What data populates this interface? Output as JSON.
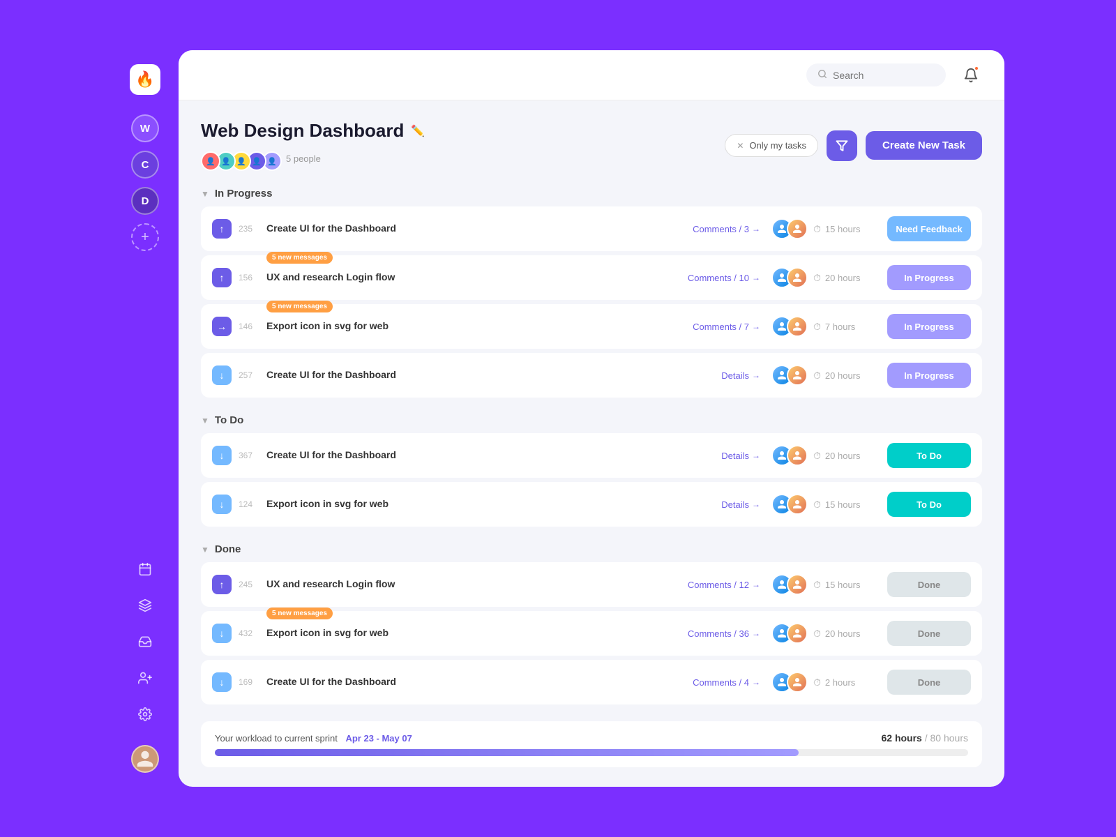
{
  "app": {
    "logo": "🔥",
    "search_placeholder": "Search"
  },
  "sidebar": {
    "workspaces": [
      {
        "label": "W",
        "class": "w"
      },
      {
        "label": "C",
        "class": "c"
      },
      {
        "label": "D",
        "class": "d"
      }
    ],
    "add_label": "+",
    "icons": [
      "📅",
      "⬡",
      "📥",
      "👤",
      "⚙️"
    ]
  },
  "header": {
    "title": "Web Design Dashboard",
    "people_count": "5 people",
    "filter_label": "Only my tasks",
    "create_btn": "Create New Task"
  },
  "sections": [
    {
      "id": "in-progress",
      "title": "In Progress",
      "tasks": [
        {
          "id": 235,
          "name": "Create UI for the Dashboard",
          "priority": "up",
          "link_label": "Comments / 3",
          "link_arrow": "→",
          "hours": "15 hours",
          "status": "Need Feedback",
          "status_class": "status-need-feedback",
          "badge": null
        },
        {
          "id": 156,
          "name": "UX and research Login flow",
          "priority": "up",
          "link_label": "Comments / 10",
          "link_arrow": "→",
          "hours": "20 hours",
          "status": "In Progress",
          "status_class": "status-in-progress",
          "badge": "5 new messages"
        },
        {
          "id": 146,
          "name": "Export icon in svg for web",
          "priority": "right",
          "link_label": "Comments / 7",
          "link_arrow": "→",
          "hours": "7 hours",
          "status": "In Progress",
          "status_class": "status-in-progress",
          "badge": "5 new messages"
        },
        {
          "id": 257,
          "name": "Create UI for the Dashboard",
          "priority": "down",
          "link_label": "Details",
          "link_arrow": "→",
          "hours": "20 hours",
          "status": "In Progress",
          "status_class": "status-in-progress",
          "badge": null
        }
      ]
    },
    {
      "id": "to-do",
      "title": "To Do",
      "tasks": [
        {
          "id": 367,
          "name": "Create UI for the Dashboard",
          "priority": "down",
          "link_label": "Details",
          "link_arrow": "→",
          "hours": "20 hours",
          "status": "To Do",
          "status_class": "status-to-do",
          "badge": null
        },
        {
          "id": 124,
          "name": "Export icon in svg for web",
          "priority": "down",
          "link_label": "Details",
          "link_arrow": "→",
          "hours": "15 hours",
          "status": "To Do",
          "status_class": "status-to-do",
          "badge": null
        }
      ]
    },
    {
      "id": "done",
      "title": "Done",
      "tasks": [
        {
          "id": 245,
          "name": "UX and research Login flow",
          "priority": "up",
          "link_label": "Comments / 12",
          "link_arrow": "→",
          "hours": "15 hours",
          "status": "Done",
          "status_class": "status-done",
          "badge": null
        },
        {
          "id": 432,
          "name": "Export icon in svg for web",
          "priority": "down",
          "link_label": "Comments / 36",
          "link_arrow": "→",
          "hours": "20 hours",
          "status": "Done",
          "status_class": "status-done",
          "badge": "5 new messages"
        },
        {
          "id": 169,
          "name": "Create UI for the Dashboard",
          "priority": "down",
          "link_label": "Comments / 4",
          "link_arrow": "→",
          "hours": "2 hours",
          "status": "Done",
          "status_class": "status-done",
          "badge": null
        }
      ]
    }
  ],
  "workload": {
    "label": "Your workload to current sprint",
    "date_range": "Apr 23 - May 07",
    "current_hours": "62 hours",
    "total_hours": "/ 80 hours",
    "progress_pct": 77.5
  },
  "priority_icons": {
    "up": "↑",
    "right": "→",
    "down": "↓"
  }
}
